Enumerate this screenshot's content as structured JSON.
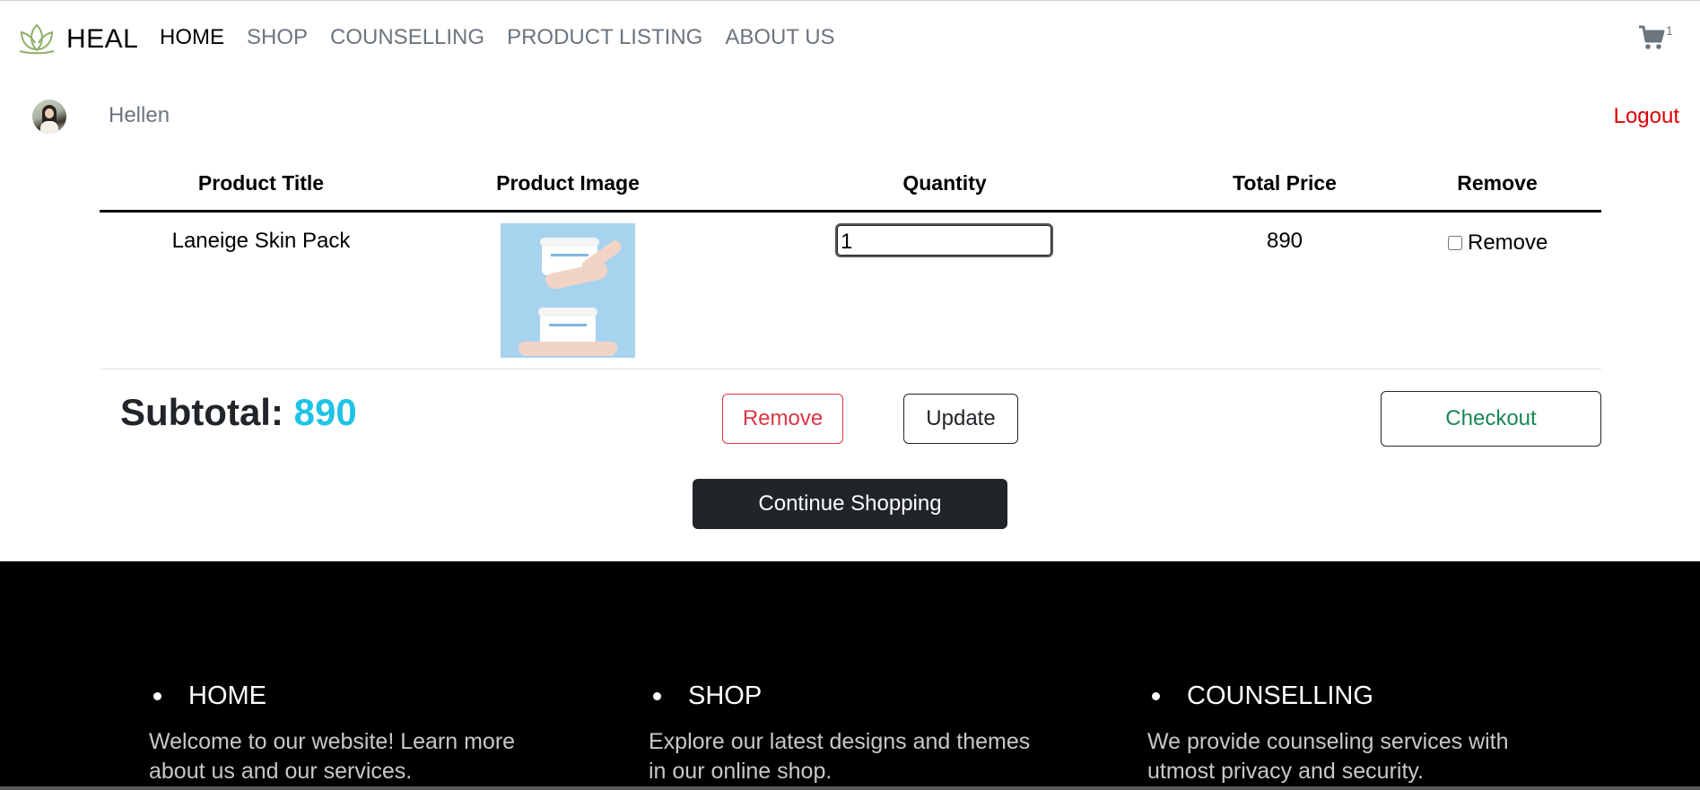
{
  "brand": {
    "name": "HEAL",
    "icon": "lotus-icon"
  },
  "nav": {
    "items": [
      {
        "label": "HOME",
        "active": true
      },
      {
        "label": "SHOP"
      },
      {
        "label": "COUNSELLING"
      },
      {
        "label": "PRODUCT LISTING"
      },
      {
        "label": "ABOUT US"
      }
    ]
  },
  "cart": {
    "icon": "cart-icon",
    "count": "1"
  },
  "user": {
    "name": "Hellen",
    "logout_label": "Logout"
  },
  "table": {
    "headers": [
      "Product Title",
      "Product Image",
      "Quantity",
      "Total Price",
      "Remove"
    ],
    "rows": [
      {
        "title": "Laneige Skin Pack",
        "quantity": "1",
        "total_price": "890",
        "remove_label": "Remove"
      }
    ]
  },
  "summary": {
    "subtotal_label": "Subtotal:",
    "subtotal_value": "890",
    "remove_label": "Remove",
    "update_label": "Update",
    "checkout_label": "Checkout",
    "continue_label": "Continue Shopping"
  },
  "footer": {
    "columns": [
      {
        "title": "HOME",
        "text": "Welcome to our website! Learn more about us and our services."
      },
      {
        "title": "SHOP",
        "text": "Explore our latest designs and themes in our online shop."
      },
      {
        "title": "COUNSELLING",
        "text": "We provide counseling services with utmost privacy and security."
      }
    ]
  },
  "colors": {
    "accent": "#1ec3e6",
    "danger": "#dc3545",
    "logout": "#dc0000",
    "checkout": "#198754",
    "dark": "#212529",
    "footer_bg": "#000000"
  }
}
